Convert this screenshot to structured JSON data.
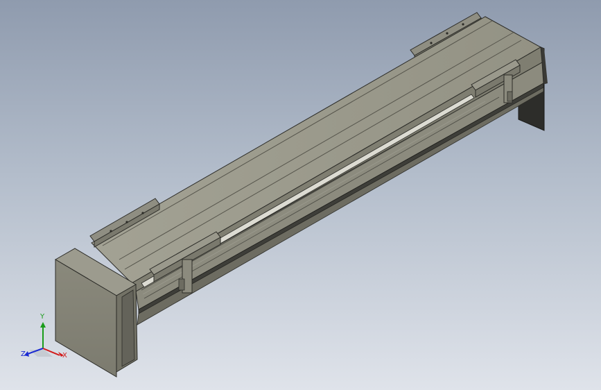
{
  "viewport": {
    "background_top": "#8f9bae",
    "background_bottom": "#dfe3ea"
  },
  "model": {
    "icon": "linear-actuator-model",
    "body_color": "#8e8d80",
    "edge_color": "#2b2b27",
    "rail_color": "#d9d8cf"
  },
  "triad": {
    "x_label": "X",
    "y_label": "Y",
    "z_label": "Z",
    "x_color": "#d21a1a",
    "y_color": "#1a9c1a",
    "z_color": "#1a2ad2"
  }
}
